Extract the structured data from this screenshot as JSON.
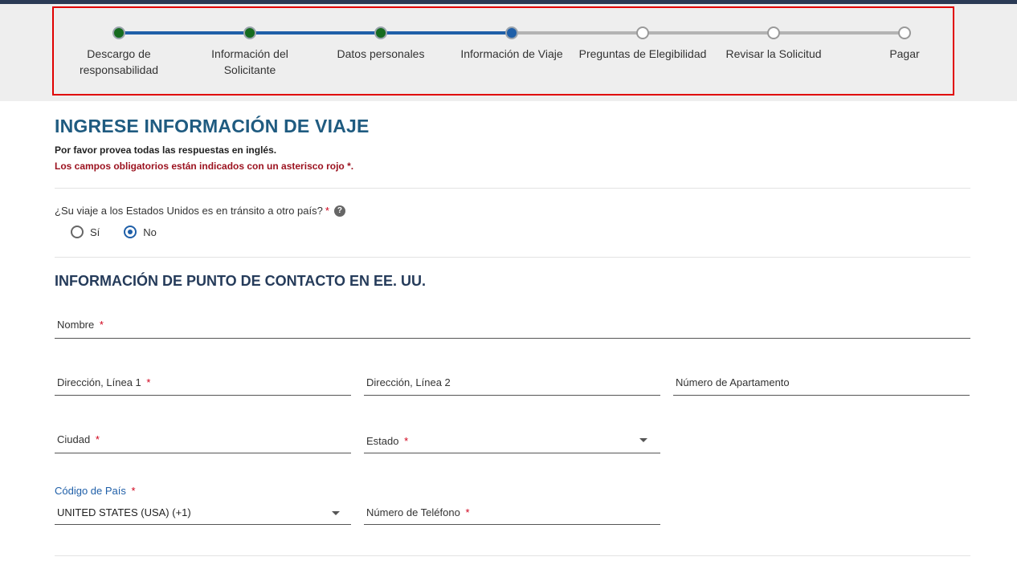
{
  "stepper": {
    "steps": [
      {
        "label": "Descargo de responsabilidad",
        "state": "complete"
      },
      {
        "label": "Información del Solicitante",
        "state": "complete"
      },
      {
        "label": "Datos personales",
        "state": "complete"
      },
      {
        "label": "Información de Viaje",
        "state": "current"
      },
      {
        "label": "Preguntas de Elegibilidad",
        "state": "pending"
      },
      {
        "label": "Revisar la Solicitud",
        "state": "pending"
      },
      {
        "label": "Pagar",
        "state": "pending"
      }
    ]
  },
  "page": {
    "title": "INGRESE INFORMACIÓN DE VIAJE",
    "note_english": "Por favor provea todas las respuestas en inglés.",
    "note_required": "Los campos obligatorios están indicados con un asterisco rojo *."
  },
  "transit": {
    "question": "¿Su viaje a los Estados Unidos es en tránsito a otro país?",
    "required_mark": "*",
    "help_icon": "question-circle-icon",
    "help_glyph": "?",
    "options": [
      "Sí",
      "No"
    ],
    "selected": "No"
  },
  "contact": {
    "section_title": "INFORMACIÓN DE PUNTO DE CONTACTO EN EE. UU.",
    "name_label": "Nombre",
    "address1_label": "Dirección, Línea 1",
    "address2_label": "Dirección, Línea 2",
    "apartment_label": "Número de Apartamento",
    "city_label": "Ciudad",
    "state_label": "Estado",
    "country_code_label": "Código de País",
    "country_code_value": "UNITED STATES (USA) (+1)",
    "phone_label": "Número de Teléfono",
    "required_mark": "*"
  },
  "colors": {
    "accent_blue": "#1f5fa8",
    "complete_green": "#166b1f",
    "required_red": "#d0021b",
    "highlight_red": "#e00000"
  }
}
